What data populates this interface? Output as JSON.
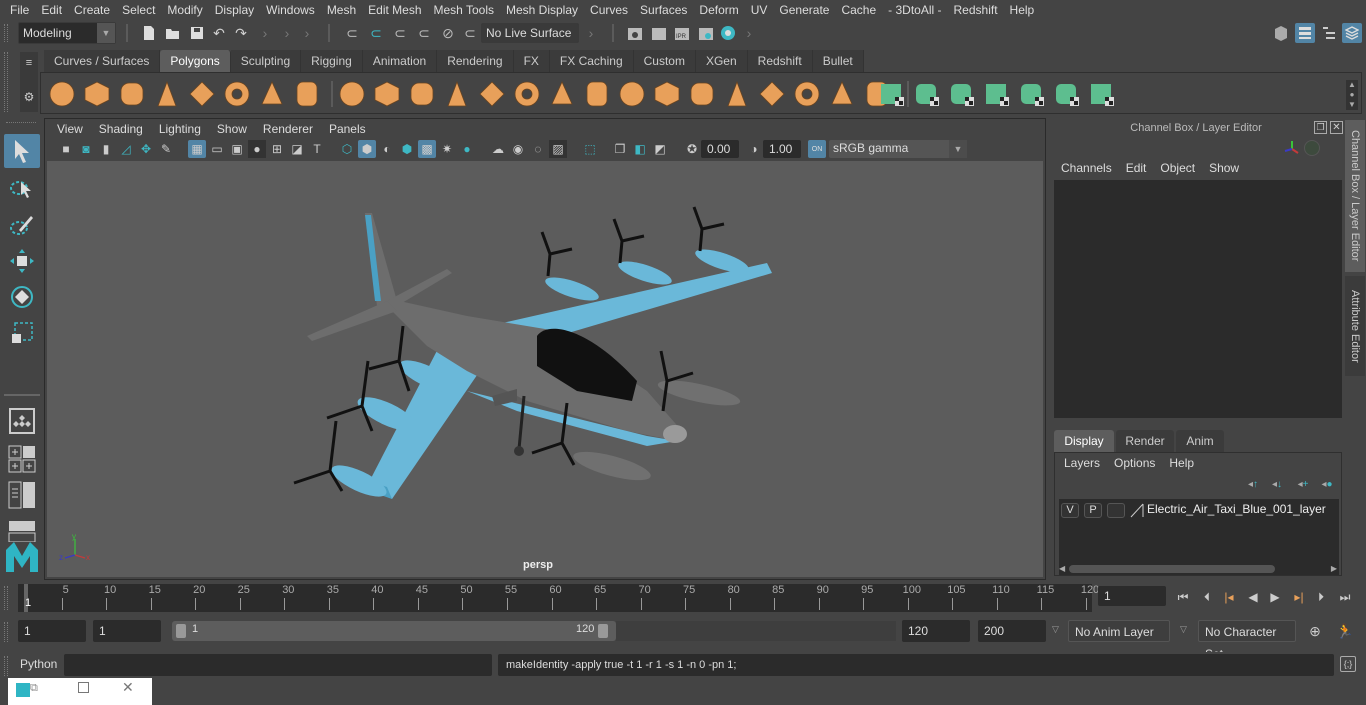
{
  "menubar": {
    "items": [
      "File",
      "Edit",
      "Create",
      "Select",
      "Modify",
      "Display",
      "Windows",
      "Mesh",
      "Edit Mesh",
      "Mesh Tools",
      "Mesh Display",
      "Curves",
      "Surfaces",
      "Deform",
      "UV",
      "Generate",
      "Cache",
      "- 3DtoAll -",
      "Redshift",
      "Help"
    ]
  },
  "statusline": {
    "mode": "Modeling",
    "live_surface": "No Live Surface",
    "icons": [
      "new-scene-icon",
      "open-scene-icon",
      "save-scene-icon",
      "undo-icon",
      "redo-icon",
      "snap-grid-icon",
      "snap-curve-icon",
      "snap-point-icon",
      "snap-view-plane-icon",
      "snap-live-icon",
      "snap-magnet-icon",
      "render-view-icon",
      "render-current-icon",
      "ipr-render-icon",
      "render-settings-icon",
      "hypershade-icon"
    ],
    "ipr_label": "IPR"
  },
  "shelf": {
    "tabs": [
      "Curves / Surfaces",
      "Polygons",
      "Sculpting",
      "Rigging",
      "Animation",
      "Rendering",
      "FX",
      "FX Caching",
      "Custom",
      "XGen",
      "Redshift",
      "Bullet"
    ],
    "active_tab": "Polygons",
    "orange_icons": [
      "poly-sphere-icon",
      "poly-cube-icon",
      "poly-cylinder-icon",
      "poly-cone-icon",
      "poly-plane-icon",
      "poly-torus-icon",
      "poly-pyramid-icon",
      "poly-pipe-icon",
      "combine-icon",
      "separate-icon",
      "mirror-icon",
      "smooth-icon",
      "extrude-icon",
      "bevel-icon",
      "bridge-icon",
      "multi-cut-icon",
      "target-weld-icon",
      "quad-draw-icon",
      "insert-edge-loop-icon",
      "fill-hole-icon",
      "add-divisions-icon",
      "merge-icon",
      "make-live-icon",
      "extract-icon"
    ],
    "green_icons": [
      "planar-uv-icon",
      "cylindrical-uv-icon",
      "spherical-uv-icon",
      "automatic-uv-icon",
      "unfold-uv-icon",
      "uv-editor-icon",
      "sew-uv-icon"
    ]
  },
  "tools": [
    "select-tool",
    "lasso-select-tool",
    "paint-select-tool",
    "move-tool",
    "rotate-tool",
    "scale-tool"
  ],
  "layouts": [
    "single-perspective-layout",
    "four-view-layout",
    "persp-outliner-layout",
    "persp-graph-layout"
  ],
  "viewport": {
    "menu": [
      "View",
      "Shading",
      "Lighting",
      "Show",
      "Renderer",
      "Panels"
    ],
    "exposure": "0.00",
    "gamma": "1.00",
    "color_mgmt": "ON",
    "view_transform": "sRGB gamma",
    "camera_label": "persp",
    "axis": {
      "x": "x",
      "y": "y",
      "z": "z"
    },
    "model_name": "Electric Air Taxi",
    "model_color": "#6ab8d9"
  },
  "channel_box": {
    "title": "Channel Box / Layer Editor",
    "menu": [
      "Channels",
      "Edit",
      "Object",
      "Show"
    ]
  },
  "layer_editor": {
    "tabs": [
      "Display",
      "Render",
      "Anim"
    ],
    "active_tab": "Display",
    "menu": [
      "Layers",
      "Options",
      "Help"
    ],
    "layers": [
      {
        "visible": "V",
        "playback": "P",
        "name": "Electric_Air_Taxi_Blue_001_layer"
      }
    ]
  },
  "side_tabs": [
    "Channel Box / Layer Editor",
    "Attribute Editor"
  ],
  "timeline": {
    "ticks": [
      5,
      10,
      15,
      20,
      25,
      30,
      35,
      40,
      45,
      50,
      55,
      60,
      65,
      70,
      75,
      80,
      85,
      90,
      95,
      100,
      105,
      110,
      115,
      120
    ],
    "current_frame_marker": "1",
    "current_frame": "1",
    "range_start": 1,
    "range_end": 120
  },
  "range_slider": {
    "start_field": "1",
    "playback_start": "1",
    "slider_start": "1",
    "slider_end": "120",
    "playback_end": "120",
    "end_field": "200",
    "anim_layer": "No Anim Layer",
    "character_set": "No Character Set"
  },
  "command_line": {
    "language": "Python",
    "input": "",
    "result": "makeIdentity -apply true -t 1 -r 1 -s 1 -n 0 -pn 1;"
  },
  "colors": {
    "accent_blue": "#5285a6",
    "shelf_orange": "#e8a05a",
    "shelf_green": "#5dbe8f",
    "teal": "#3eb8c4"
  }
}
